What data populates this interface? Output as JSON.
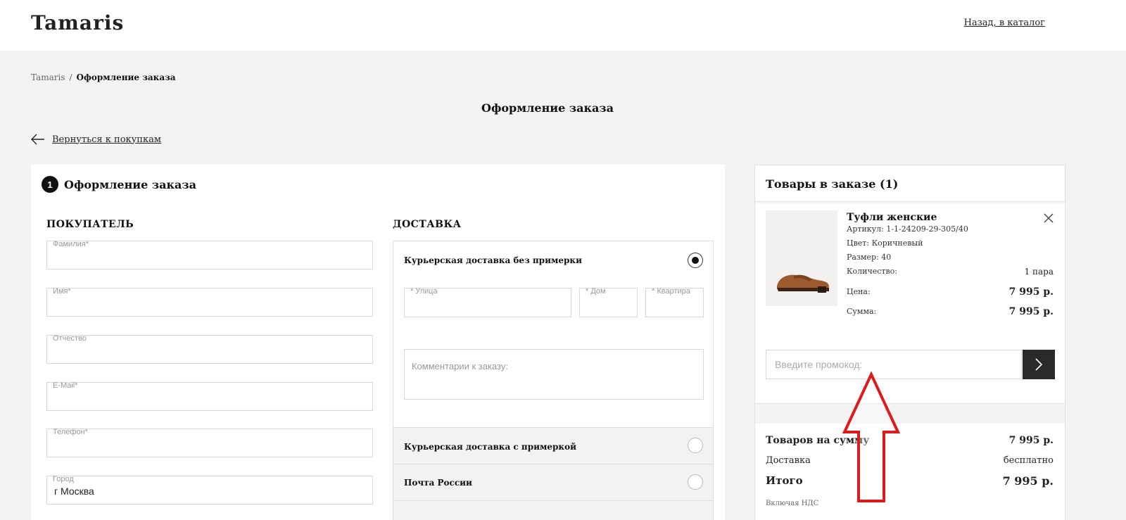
{
  "header": {
    "logo_text": "Tamaris",
    "back_catalog": "Назад, в каталог"
  },
  "breadcrumb": {
    "home": "Tamaris",
    "separator": "/",
    "current": "Оформление заказа"
  },
  "page_title": "Оформление заказа",
  "back_shopping": "Вернуться к покупкам",
  "checkout": {
    "step_number": "1",
    "step_title": "Оформление заказа",
    "buyer": {
      "title": "ПОКУПАТЕЛЬ",
      "fields": [
        {
          "label": "Фамилия*",
          "value": ""
        },
        {
          "label": "Имя*",
          "value": ""
        },
        {
          "label": "Отчество",
          "value": ""
        },
        {
          "label": "E-Mail*",
          "value": ""
        },
        {
          "label": "Телефон*",
          "value": ""
        },
        {
          "label": "Город",
          "value": "г Москва"
        }
      ]
    },
    "delivery": {
      "title": "ДОСТАВКА",
      "options": [
        {
          "label": "Курьерская доставка без примерки",
          "selected": true
        },
        {
          "label": "Курьерская доставка с примеркой",
          "selected": false
        },
        {
          "label": "Почта России",
          "selected": false
        }
      ],
      "street_label": "* Улица",
      "house_label": "* Дом",
      "apartment_label": "* Квартира",
      "comment_placeholder": "Комментарии к заказу:"
    }
  },
  "cart": {
    "title": "Товары в заказе (1)",
    "item": {
      "name": "Туфли женские",
      "article": "Артикул: 1-1-24209-29-305/40",
      "color": "Цвет: Коричневый",
      "size": "Размер: 40",
      "quantity_label": "Количество:",
      "quantity_value": "1 пара",
      "price_label": "Цена:",
      "price_value": "7 995 р.",
      "sum_label": "Сумма:",
      "sum_value": "7 995 р."
    },
    "promo_placeholder": "Введите промокод:",
    "totals": {
      "goods_label": "Товаров на сумму",
      "goods_value": "7 995 р.",
      "delivery_label": "Доставка",
      "delivery_value": "бесплатно",
      "total_label": "Итого",
      "total_value": "7 995 р.",
      "vat_note": "Включая НДС"
    }
  },
  "colors": {
    "accent_dark": "#2a2a2a",
    "annotation_arrow": "#e0191b",
    "page_bg": "#f4f3f1"
  }
}
